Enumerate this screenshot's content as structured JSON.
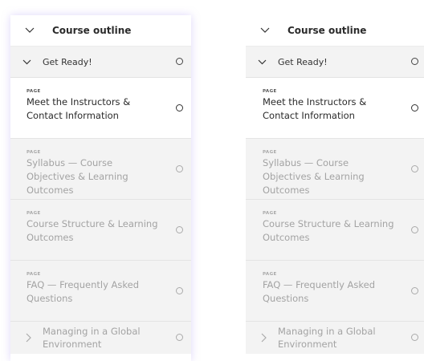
{
  "panels": [
    {
      "outline_title": "Course outline",
      "section": {
        "title": "Get Ready!"
      },
      "items": [
        {
          "type": "PAGE",
          "title": "Meet the Instructors & Contact Information"
        },
        {
          "type": "PAGE",
          "title": "Syllabus — Course Objectives & Learning Outcomes"
        },
        {
          "type": "PAGE",
          "title": "Course Structure & Learning Outcomes"
        },
        {
          "type": "PAGE",
          "title": "FAQ — Frequently Asked Questions"
        }
      ],
      "subsection": {
        "title": "Managing in a Global Environment"
      }
    },
    {
      "outline_title": "Course outline",
      "section": {
        "title": "Get Ready!"
      },
      "items": [
        {
          "type": "PAGE",
          "title": "Meet the Instructors & Contact Information"
        },
        {
          "type": "PAGE",
          "title": "Syllabus — Course Objectives & Learning Outcomes"
        },
        {
          "type": "PAGE",
          "title": "Course Structure & Learning Outcomes"
        },
        {
          "type": "PAGE",
          "title": "FAQ — Frequently Asked Questions"
        }
      ],
      "subsection": {
        "title": "Managing in a Global Environment"
      }
    }
  ],
  "icons": {
    "collapse": "chevron-down-icon",
    "expand": "chevron-right-icon",
    "status": "circle-status-icon"
  },
  "colors": {
    "focus_glow": "#a28cf0",
    "section_bg": "#f3f3f3",
    "active_bg": "#ffffff",
    "muted_text": "#a3a3a3",
    "text": "#2b2b2b"
  }
}
